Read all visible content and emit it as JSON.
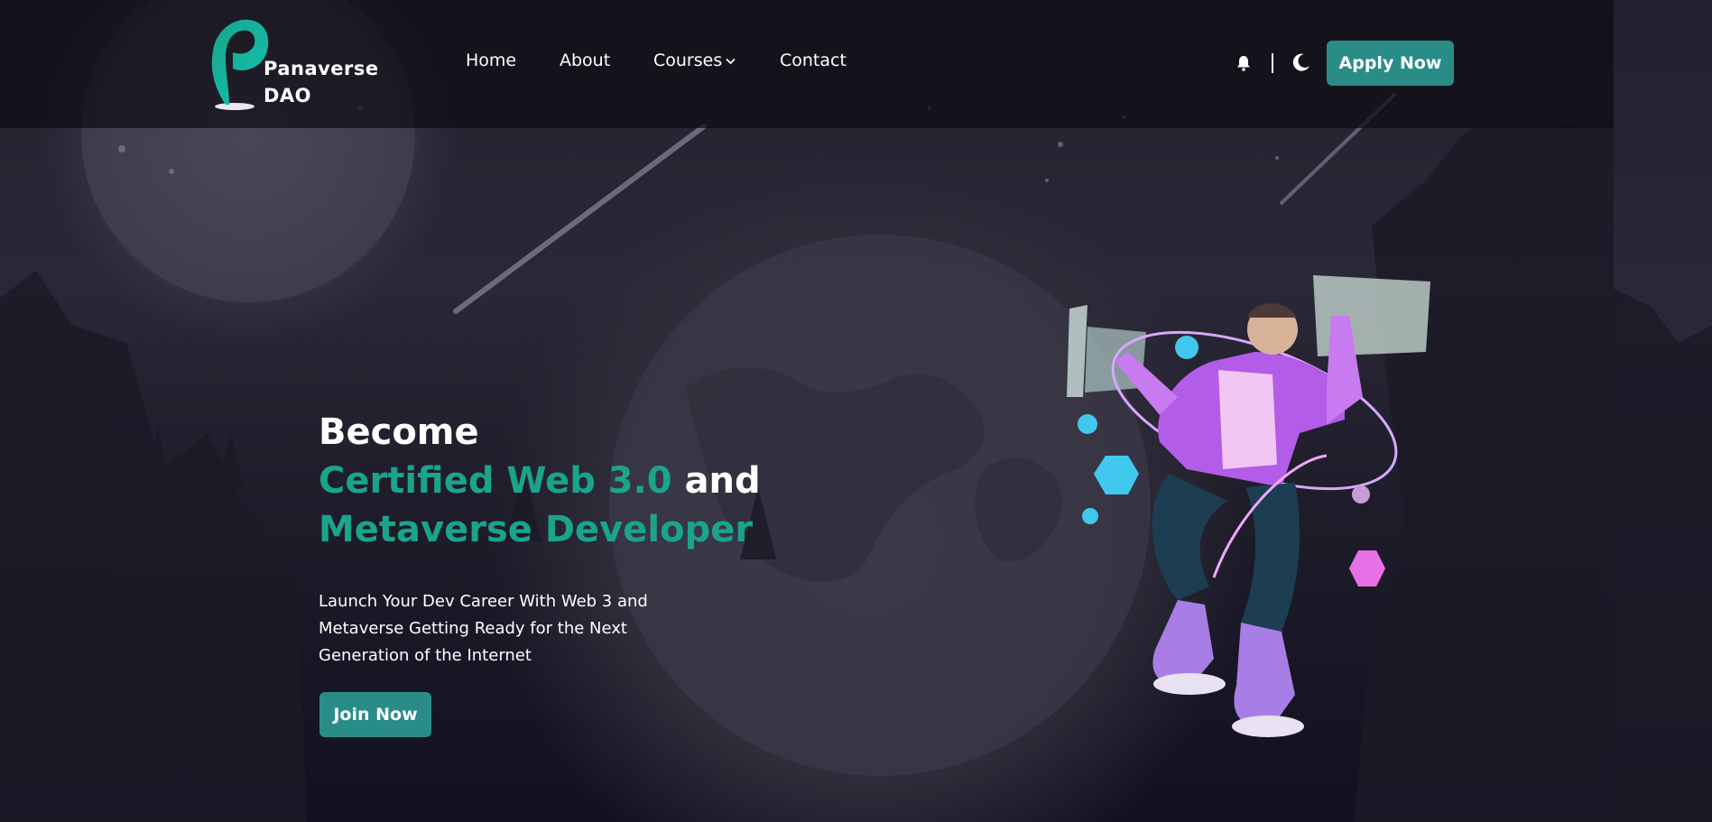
{
  "brand": {
    "name_line1": "Panaverse",
    "name_line2": "DAO",
    "accent": "#1aa48c",
    "button_color": "#2a8c87"
  },
  "nav": {
    "items": [
      {
        "label": "Home"
      },
      {
        "label": "About"
      },
      {
        "label": "Courses"
      },
      {
        "label": "Contact"
      }
    ]
  },
  "header_actions": {
    "notification_icon": "bell-icon",
    "theme_icon": "moon-icon",
    "apply_label": "Apply Now"
  },
  "hero": {
    "line1": "Become",
    "line2_accent": "Certified Web 3.0",
    "line2_rest": "and",
    "line3_accent": "Metaverse Developer",
    "subtitle": "Launch Your Dev Career With Web 3 and Metaverse Getting Ready for the Next Generation of the Internet",
    "cta_label": "Join Now"
  }
}
